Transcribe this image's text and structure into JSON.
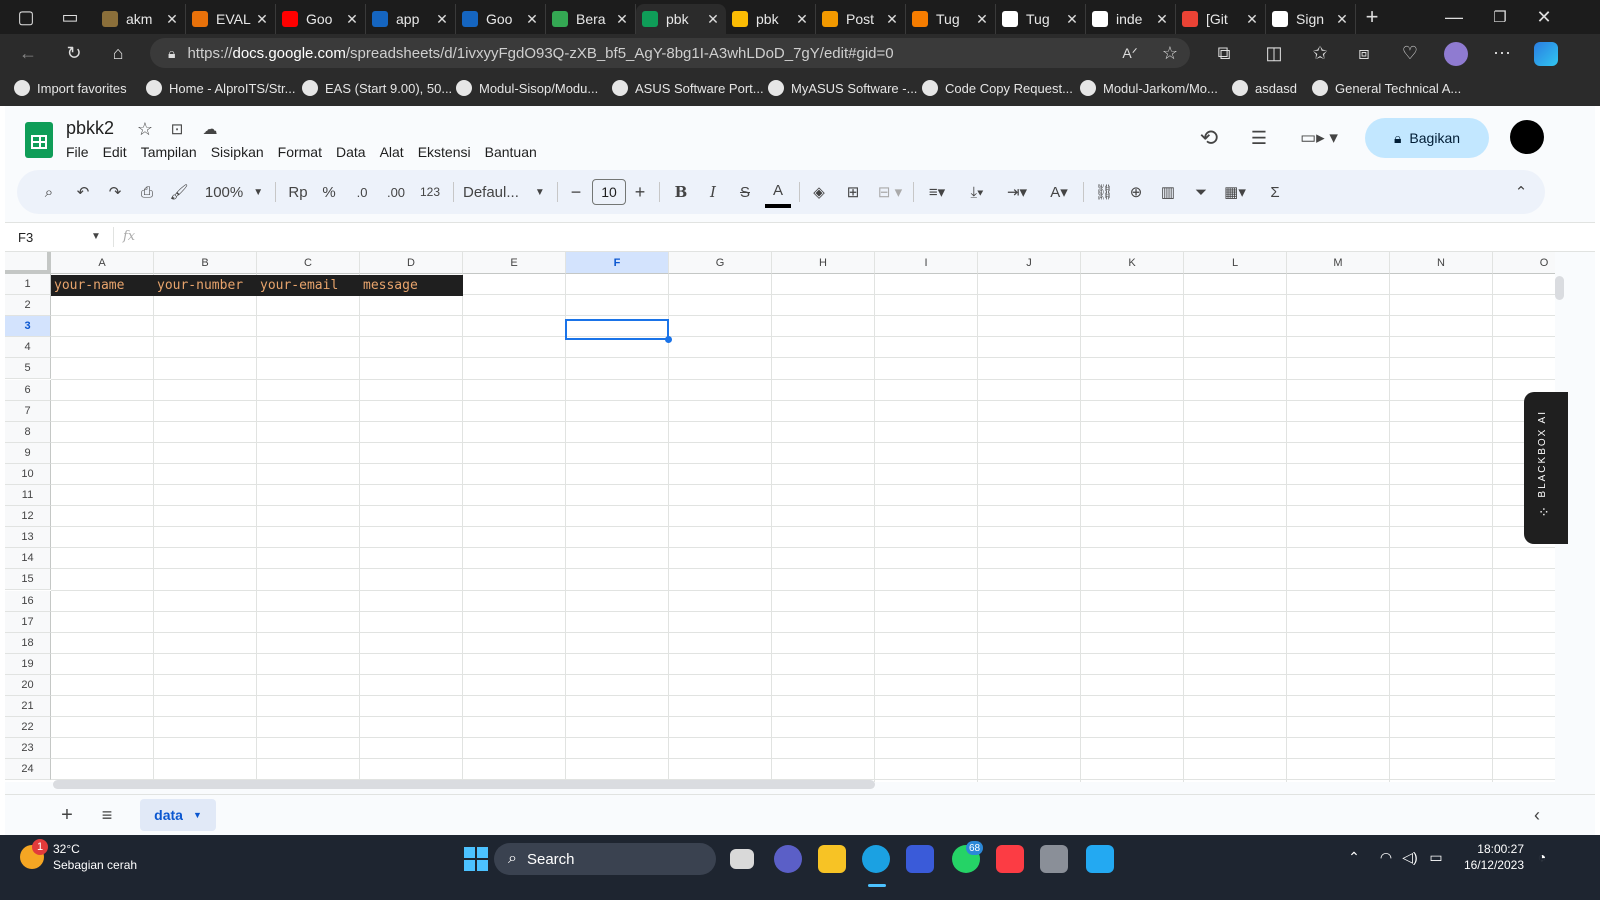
{
  "browser": {
    "tabs": [
      {
        "title": "akm",
        "color": "#8b6f3a"
      },
      {
        "title": "EVAL",
        "color": "#e8710a"
      },
      {
        "title": "Goo",
        "color": "#ff0000"
      },
      {
        "title": "app",
        "color": "#1565c0"
      },
      {
        "title": "Goo",
        "color": "#1565c0"
      },
      {
        "title": "Bera",
        "color": "#34a853"
      },
      {
        "title": "pbk",
        "color": "#0f9d58"
      },
      {
        "title": "pbk",
        "color": "#fbbc04"
      },
      {
        "title": "Post",
        "color": "#f29900"
      },
      {
        "title": "Tug",
        "color": "#f57c00"
      },
      {
        "title": "Tug",
        "color": "#ffffff"
      },
      {
        "title": "inde",
        "color": "#ffffff"
      },
      {
        "title": "[Git",
        "color": "#ea4335"
      },
      {
        "title": "Sign",
        "color": "#ffffff"
      }
    ],
    "url_host": "docs.google.com",
    "url_prefix": "https://",
    "url_path": "/spreadsheets/d/1ivxyyFgdO93Q-zXB_bf5_AgY-8bg1I-A3whLDoD_7gY/edit#gid=0",
    "favorites": [
      "Import favorites",
      "Home - AlproITS/Str...",
      "EAS (Start 9.00), 50...",
      "Modul-Sisop/Modu...",
      "ASUS Software Port...",
      "MyASUS Software -...",
      "Code Copy Request...",
      "Modul-Jarkom/Mo...",
      "asdasd",
      "General Technical A..."
    ]
  },
  "sheets": {
    "doc_title": "pbkk2",
    "menu": [
      "File",
      "Edit",
      "Tampilan",
      "Sisipkan",
      "Format",
      "Data",
      "Alat",
      "Ekstensi",
      "Bantuan"
    ],
    "share_label": "Bagikan",
    "toolbar": {
      "zoom": "100%",
      "currency": "Rp",
      "percent": "%",
      "dec_less": ".0",
      "dec_more": ".00",
      "number_format": "123",
      "font": "Defaul...",
      "font_size": "10"
    },
    "name_box": "F3",
    "fx": "fx",
    "columns": [
      "A",
      "B",
      "C",
      "D",
      "E",
      "F",
      "G",
      "H",
      "I",
      "J",
      "K",
      "L",
      "M",
      "N",
      "O"
    ],
    "selected_column": "F",
    "rows": [
      "1",
      "2",
      "3",
      "4",
      "5",
      "6",
      "7",
      "8",
      "9",
      "10",
      "11",
      "12",
      "13",
      "14",
      "15",
      "16",
      "17",
      "18",
      "19",
      "20",
      "21",
      "22",
      "23",
      "24"
    ],
    "selected_row": "3",
    "header_cells": [
      "your-name",
      "your-number",
      "your-email",
      "message"
    ],
    "sheet_tab": "data",
    "blackbox_label": "BLACKBOX AI"
  },
  "taskbar": {
    "weather_temp": "32°C",
    "weather_desc": "Sebagian cerah",
    "weather_badge": "1",
    "search_label": "Search",
    "whatsapp_badge": "68",
    "time": "18:00:27",
    "date": "16/12/2023"
  }
}
